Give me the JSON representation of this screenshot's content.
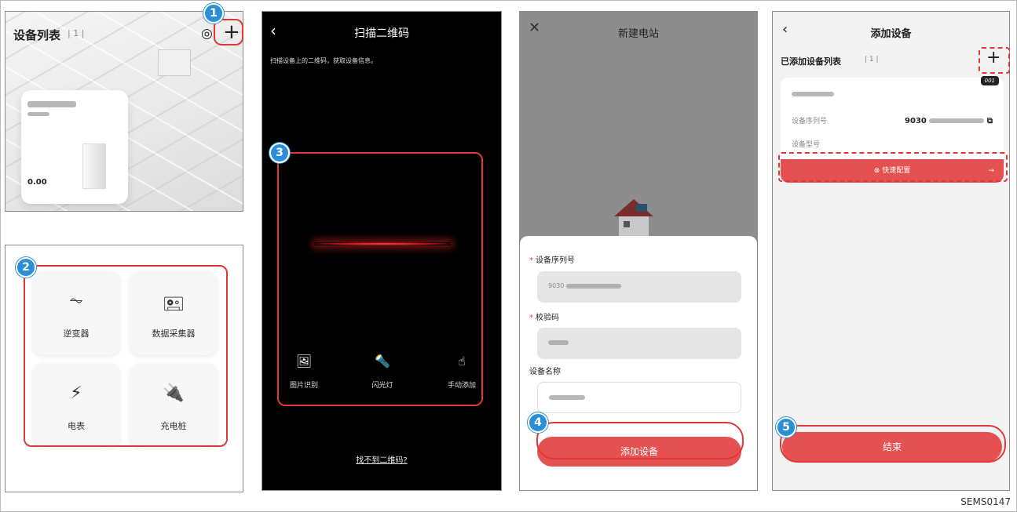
{
  "colors": {
    "accent_red": "#e55050",
    "marker_blue": "#2a8fd6",
    "highlight_red": "#e03838"
  },
  "panel1": {
    "title": "设备列表",
    "count": "1",
    "add_icon": "plus-icon",
    "target_icon": "target-icon",
    "card_value": "0.00"
  },
  "panel2": {
    "items": [
      {
        "label": "逆变器",
        "icon": "inverter-icon",
        "glyph": "⏦"
      },
      {
        "label": "数据采集器",
        "icon": "datalogger-icon",
        "glyph": "🖭"
      },
      {
        "label": "电表",
        "icon": "meter-icon",
        "glyph": "⚡"
      },
      {
        "label": "充电桩",
        "icon": "charger-icon",
        "glyph": "🔌"
      }
    ]
  },
  "panel3": {
    "title": "扫描二维码",
    "hint": "扫描设备上的二维码，获取设备信息。",
    "tools": [
      {
        "label": "图片识别",
        "icon": "image-icon",
        "glyph": "🖼"
      },
      {
        "label": "闪光灯",
        "icon": "flashlight-icon",
        "glyph": "🔦"
      },
      {
        "label": "手动添加",
        "icon": "manual-add-icon",
        "glyph": "☝"
      }
    ],
    "not_found": "找不到二维码?"
  },
  "panel4": {
    "title": "新建电站",
    "serial_label": "设备序列号",
    "serial_value": "9030",
    "check_label": "校验码",
    "name_label": "设备名称",
    "add_button": "添加设备"
  },
  "panel5": {
    "title": "添加设备",
    "list_title": "已添加设备列表",
    "count": "1",
    "tag": "001",
    "serial_label": "设备序列号",
    "serial_value": "9030",
    "model_label": "设备型号",
    "quick_config": "快速配置",
    "end_button": "结束"
  },
  "markers": [
    "1",
    "2",
    "3",
    "4",
    "5"
  ],
  "caption": "SEMS0147"
}
